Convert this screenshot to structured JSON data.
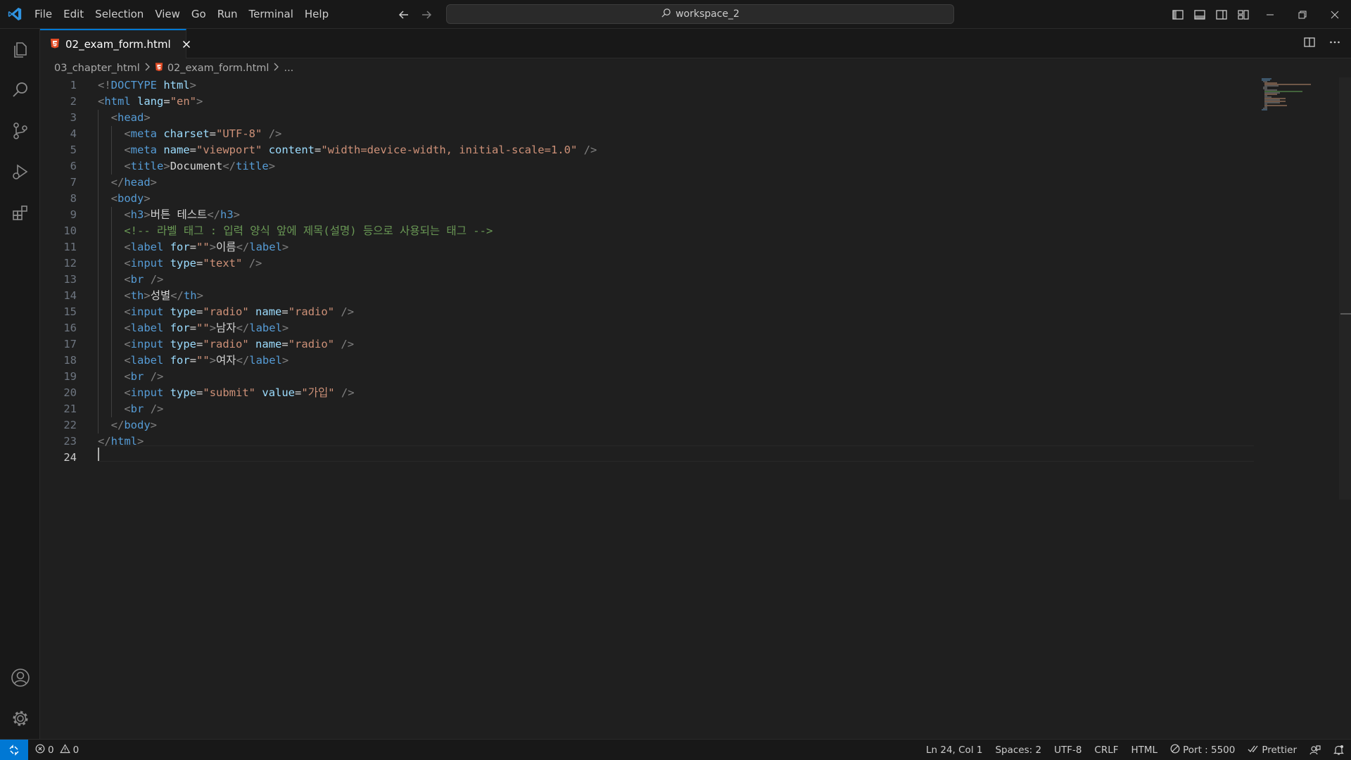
{
  "titlebar": {
    "menu": [
      "File",
      "Edit",
      "Selection",
      "View",
      "Go",
      "Run",
      "Terminal",
      "Help"
    ],
    "search_label": "workspace_2"
  },
  "tab": {
    "label": "02_exam_form.html"
  },
  "breadcrumb": {
    "folder": "03_chapter_html",
    "file": "02_exam_form.html",
    "more": "..."
  },
  "editor": {
    "lines": [
      [
        [
          "t-tag",
          "<!"
        ],
        [
          "t-name",
          "DOCTYPE"
        ],
        [
          "t-text",
          " "
        ],
        [
          "t-attr",
          "html"
        ],
        [
          "t-tag",
          ">"
        ]
      ],
      [
        [
          "t-tag",
          "<"
        ],
        [
          "t-name",
          "html"
        ],
        [
          "t-text",
          " "
        ],
        [
          "t-attr",
          "lang"
        ],
        [
          "t-text",
          "="
        ],
        [
          "t-str",
          "\"en\""
        ],
        [
          "t-tag",
          ">"
        ]
      ],
      [
        [
          "t-text",
          "  "
        ],
        [
          "t-tag",
          "<"
        ],
        [
          "t-name",
          "head"
        ],
        [
          "t-tag",
          ">"
        ]
      ],
      [
        [
          "t-text",
          "    "
        ],
        [
          "t-tag",
          "<"
        ],
        [
          "t-name",
          "meta"
        ],
        [
          "t-text",
          " "
        ],
        [
          "t-attr",
          "charset"
        ],
        [
          "t-text",
          "="
        ],
        [
          "t-str",
          "\"UTF-8\""
        ],
        [
          "t-text",
          " "
        ],
        [
          "t-tag",
          "/>"
        ]
      ],
      [
        [
          "t-text",
          "    "
        ],
        [
          "t-tag",
          "<"
        ],
        [
          "t-name",
          "meta"
        ],
        [
          "t-text",
          " "
        ],
        [
          "t-attr",
          "name"
        ],
        [
          "t-text",
          "="
        ],
        [
          "t-str",
          "\"viewport\""
        ],
        [
          "t-text",
          " "
        ],
        [
          "t-attr",
          "content"
        ],
        [
          "t-text",
          "="
        ],
        [
          "t-str",
          "\"width=device-width, initial-scale=1.0\""
        ],
        [
          "t-text",
          " "
        ],
        [
          "t-tag",
          "/>"
        ]
      ],
      [
        [
          "t-text",
          "    "
        ],
        [
          "t-tag",
          "<"
        ],
        [
          "t-name",
          "title"
        ],
        [
          "t-tag",
          ">"
        ],
        [
          "t-text",
          "Document"
        ],
        [
          "t-tag",
          "</"
        ],
        [
          "t-name",
          "title"
        ],
        [
          "t-tag",
          ">"
        ]
      ],
      [
        [
          "t-text",
          "  "
        ],
        [
          "t-tag",
          "</"
        ],
        [
          "t-name",
          "head"
        ],
        [
          "t-tag",
          ">"
        ]
      ],
      [
        [
          "t-text",
          "  "
        ],
        [
          "t-tag",
          "<"
        ],
        [
          "t-name",
          "body"
        ],
        [
          "t-tag",
          ">"
        ]
      ],
      [
        [
          "t-text",
          "    "
        ],
        [
          "t-tag",
          "<"
        ],
        [
          "t-name",
          "h3"
        ],
        [
          "t-tag",
          ">"
        ],
        [
          "t-text",
          "버튼 테스트"
        ],
        [
          "t-tag",
          "</"
        ],
        [
          "t-name",
          "h3"
        ],
        [
          "t-tag",
          ">"
        ]
      ],
      [
        [
          "t-text",
          "    "
        ],
        [
          "t-comment",
          "<!-- 라벨 태그 : 입력 양식 앞에 제목(설명) 등으로 사용되는 태그 -->"
        ]
      ],
      [
        [
          "t-text",
          "    "
        ],
        [
          "t-tag",
          "<"
        ],
        [
          "t-name",
          "label"
        ],
        [
          "t-text",
          " "
        ],
        [
          "t-attr",
          "for"
        ],
        [
          "t-text",
          "="
        ],
        [
          "t-str",
          "\"\""
        ],
        [
          "t-tag",
          ">"
        ],
        [
          "t-text",
          "이름"
        ],
        [
          "t-tag",
          "</"
        ],
        [
          "t-name",
          "label"
        ],
        [
          "t-tag",
          ">"
        ]
      ],
      [
        [
          "t-text",
          "    "
        ],
        [
          "t-tag",
          "<"
        ],
        [
          "t-name",
          "input"
        ],
        [
          "t-text",
          " "
        ],
        [
          "t-attr",
          "type"
        ],
        [
          "t-text",
          "="
        ],
        [
          "t-str",
          "\"text\""
        ],
        [
          "t-text",
          " "
        ],
        [
          "t-tag",
          "/>"
        ]
      ],
      [
        [
          "t-text",
          "    "
        ],
        [
          "t-tag",
          "<"
        ],
        [
          "t-name",
          "br"
        ],
        [
          "t-text",
          " "
        ],
        [
          "t-tag",
          "/>"
        ]
      ],
      [
        [
          "t-text",
          "    "
        ],
        [
          "t-tag",
          "<"
        ],
        [
          "t-name",
          "th"
        ],
        [
          "t-tag",
          ">"
        ],
        [
          "t-text",
          "성별"
        ],
        [
          "t-tag",
          "</"
        ],
        [
          "t-name",
          "th"
        ],
        [
          "t-tag",
          ">"
        ]
      ],
      [
        [
          "t-text",
          "    "
        ],
        [
          "t-tag",
          "<"
        ],
        [
          "t-name",
          "input"
        ],
        [
          "t-text",
          " "
        ],
        [
          "t-attr",
          "type"
        ],
        [
          "t-text",
          "="
        ],
        [
          "t-str",
          "\"radio\""
        ],
        [
          "t-text",
          " "
        ],
        [
          "t-attr",
          "name"
        ],
        [
          "t-text",
          "="
        ],
        [
          "t-str",
          "\"radio\""
        ],
        [
          "t-text",
          " "
        ],
        [
          "t-tag",
          "/>"
        ]
      ],
      [
        [
          "t-text",
          "    "
        ],
        [
          "t-tag",
          "<"
        ],
        [
          "t-name",
          "label"
        ],
        [
          "t-text",
          " "
        ],
        [
          "t-attr",
          "for"
        ],
        [
          "t-text",
          "="
        ],
        [
          "t-str",
          "\"\""
        ],
        [
          "t-tag",
          ">"
        ],
        [
          "t-text",
          "남자"
        ],
        [
          "t-tag",
          "</"
        ],
        [
          "t-name",
          "label"
        ],
        [
          "t-tag",
          ">"
        ]
      ],
      [
        [
          "t-text",
          "    "
        ],
        [
          "t-tag",
          "<"
        ],
        [
          "t-name",
          "input"
        ],
        [
          "t-text",
          " "
        ],
        [
          "t-attr",
          "type"
        ],
        [
          "t-text",
          "="
        ],
        [
          "t-str",
          "\"radio\""
        ],
        [
          "t-text",
          " "
        ],
        [
          "t-attr",
          "name"
        ],
        [
          "t-text",
          "="
        ],
        [
          "t-str",
          "\"radio\""
        ],
        [
          "t-text",
          " "
        ],
        [
          "t-tag",
          "/>"
        ]
      ],
      [
        [
          "t-text",
          "    "
        ],
        [
          "t-tag",
          "<"
        ],
        [
          "t-name",
          "label"
        ],
        [
          "t-text",
          " "
        ],
        [
          "t-attr",
          "for"
        ],
        [
          "t-text",
          "="
        ],
        [
          "t-str",
          "\"\""
        ],
        [
          "t-tag",
          ">"
        ],
        [
          "t-text",
          "여자"
        ],
        [
          "t-tag",
          "</"
        ],
        [
          "t-name",
          "label"
        ],
        [
          "t-tag",
          ">"
        ]
      ],
      [
        [
          "t-text",
          "    "
        ],
        [
          "t-tag",
          "<"
        ],
        [
          "t-name",
          "br"
        ],
        [
          "t-text",
          " "
        ],
        [
          "t-tag",
          "/>"
        ]
      ],
      [
        [
          "t-text",
          "    "
        ],
        [
          "t-tag",
          "<"
        ],
        [
          "t-name",
          "input"
        ],
        [
          "t-text",
          " "
        ],
        [
          "t-attr",
          "type"
        ],
        [
          "t-text",
          "="
        ],
        [
          "t-str",
          "\"submit\""
        ],
        [
          "t-text",
          " "
        ],
        [
          "t-attr",
          "value"
        ],
        [
          "t-text",
          "="
        ],
        [
          "t-str",
          "\"가입\""
        ],
        [
          "t-text",
          " "
        ],
        [
          "t-tag",
          "/>"
        ]
      ],
      [
        [
          "t-text",
          "    "
        ],
        [
          "t-tag",
          "<"
        ],
        [
          "t-name",
          "br"
        ],
        [
          "t-text",
          " "
        ],
        [
          "t-tag",
          "/>"
        ]
      ],
      [
        [
          "t-text",
          "  "
        ],
        [
          "t-tag",
          "</"
        ],
        [
          "t-name",
          "body"
        ],
        [
          "t-tag",
          ">"
        ]
      ],
      [
        [
          "t-tag",
          "</"
        ],
        [
          "t-name",
          "html"
        ],
        [
          "t-tag",
          ">"
        ]
      ],
      []
    ],
    "active_line": 24
  },
  "statusbar": {
    "errors": "0",
    "warnings": "0",
    "position": "Ln 24, Col 1",
    "spaces": "Spaces: 2",
    "encoding": "UTF-8",
    "eol": "CRLF",
    "language": "HTML",
    "port": "Port : 5500",
    "formatter": "Prettier"
  },
  "colors": {
    "accent": "#0078d4",
    "html_icon": "#e44d26"
  }
}
